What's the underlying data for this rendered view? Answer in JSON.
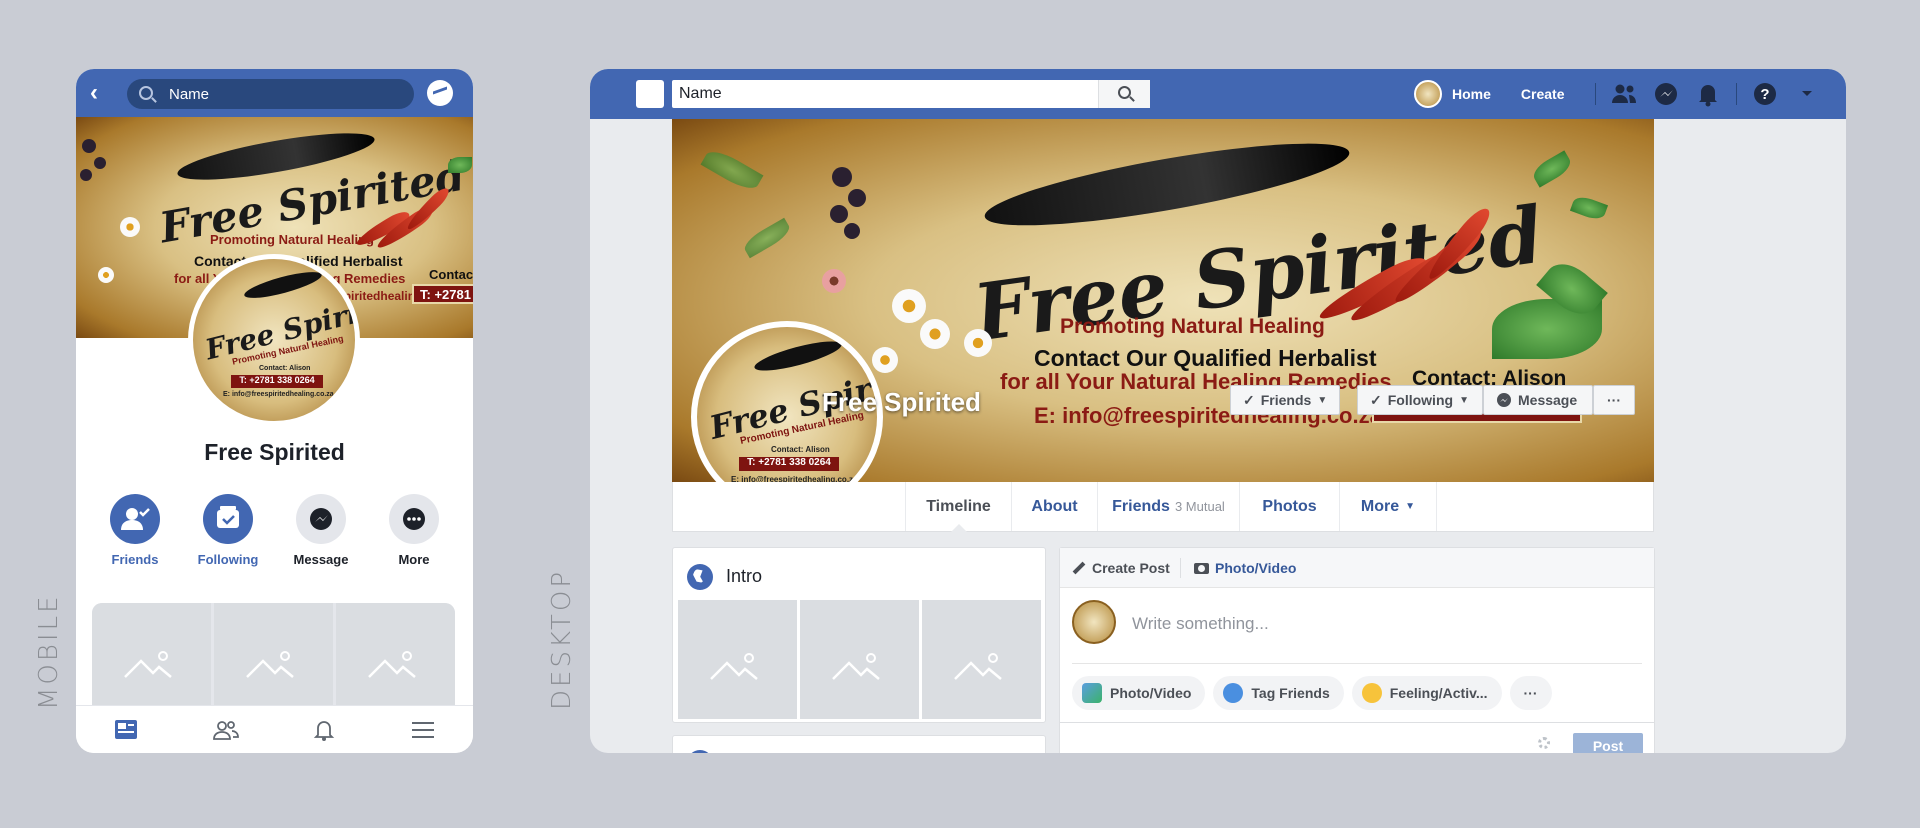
{
  "labels": {
    "mobile": "MOBILE",
    "desktop": "DESKTOP"
  },
  "brand": {
    "script_title": "Free Spirited",
    "tagline": "Promoting Natural Healing",
    "contact_line1": "Contact Our Qualified Herbalist",
    "contact_line2": "for all Your Natural Healing Remedies",
    "email": "E: info@freespiritedhealing.co.za",
    "contact_name": "Contact: Alison",
    "phone": "T: +2781 338 0264",
    "avatar_contact": "Contact: Alison",
    "avatar_email": "E: info@freespiritedhealing.co.za"
  },
  "mobile": {
    "search_value": "Name",
    "page_name": "Free Spirited",
    "actions": [
      {
        "label": "Friends"
      },
      {
        "label": "Following"
      },
      {
        "label": "Message"
      },
      {
        "label": "More"
      }
    ]
  },
  "desktop": {
    "search_value": "Name",
    "nav": {
      "home": "Home",
      "create": "Create"
    },
    "page_name": "Free Spirited",
    "buttons": {
      "friends": "Friends",
      "following": "Following",
      "message": "Message",
      "more": "···"
    },
    "tabs": {
      "timeline": "Timeline",
      "about": "About",
      "friends": "Friends",
      "friends_sub": "3 Mutual",
      "photos": "Photos",
      "more": "More"
    },
    "intro_title": "Intro",
    "post": {
      "create_post": "Create Post",
      "photo_video_tab": "Photo/Video",
      "placeholder": "Write something...",
      "chips": [
        "Photo/Video",
        "Tag Friends",
        "Feeling/Activ...",
        "···"
      ],
      "post_button": "Post"
    }
  },
  "colors": {
    "brand_blue": "#4267b2",
    "dark_blue": "#29487d",
    "link_blue": "#365899",
    "plaque_red": "#7e1410"
  }
}
